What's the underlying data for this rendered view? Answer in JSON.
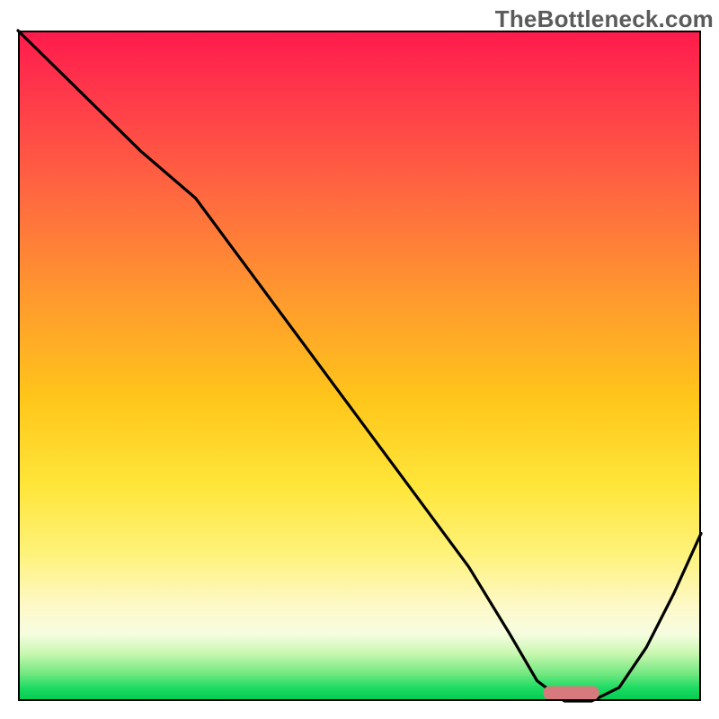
{
  "watermark": "TheBottleneck.com",
  "chart_data": {
    "type": "line",
    "title": "",
    "xlabel": "",
    "ylabel": "",
    "xlim": [
      0,
      100
    ],
    "ylim": [
      0,
      100
    ],
    "grid": false,
    "series": [
      {
        "name": "bottleneck-curve",
        "x": [
          0,
          8,
          18,
          26,
          34,
          42,
          50,
          58,
          66,
          72,
          76,
          80,
          84,
          88,
          92,
          96,
          100
        ],
        "values": [
          100,
          92,
          82,
          75,
          64,
          53,
          42,
          31,
          20,
          10,
          3,
          0,
          0,
          2,
          8,
          16,
          25
        ]
      }
    ],
    "optimal_marker": {
      "x_start": 77,
      "x_end": 85,
      "y": 1.2
    },
    "background_gradient_stops": [
      {
        "pos": 0.0,
        "color": "#ff1a4d"
      },
      {
        "pos": 0.25,
        "color": "#ff6a3f"
      },
      {
        "pos": 0.55,
        "color": "#ffc61a"
      },
      {
        "pos": 0.78,
        "color": "#fef27a"
      },
      {
        "pos": 0.93,
        "color": "#c7f7af"
      },
      {
        "pos": 1.0,
        "color": "#00c94f"
      }
    ]
  }
}
